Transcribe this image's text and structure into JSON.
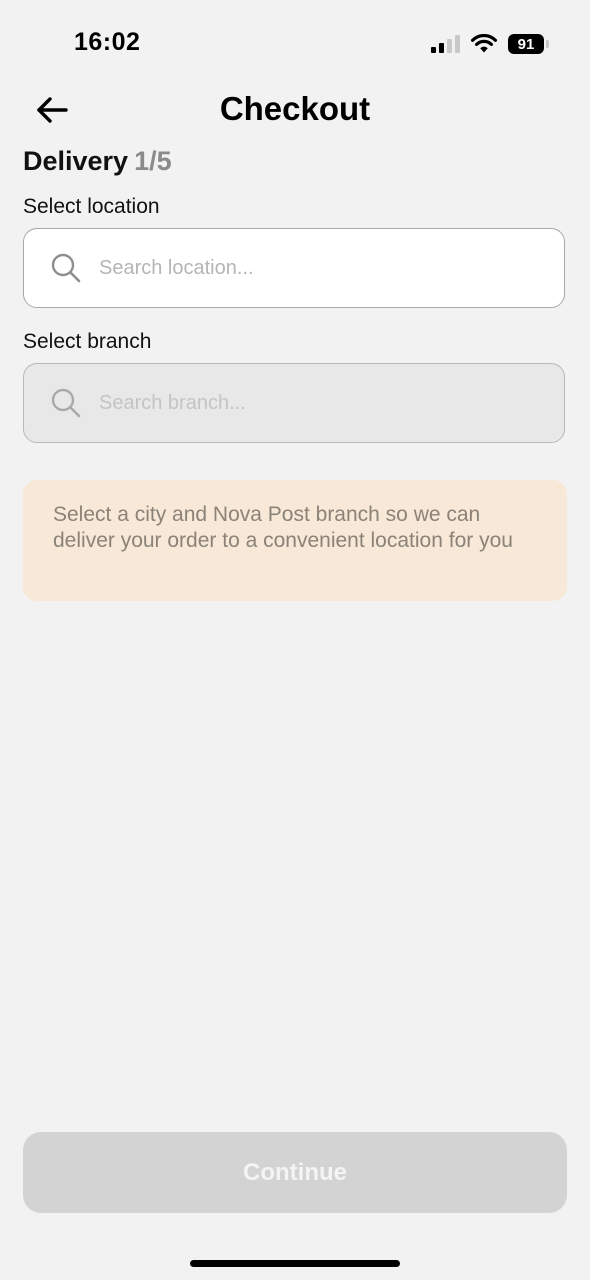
{
  "status_bar": {
    "time": "16:02",
    "battery_level": "91",
    "signal_bars_active": 2,
    "signal_bars_total": 4,
    "wifi_icon": "wifi-icon"
  },
  "header": {
    "back_icon": "arrow-left-icon",
    "title": "Checkout"
  },
  "step": {
    "title": "Delivery",
    "count": "1/5"
  },
  "location": {
    "label": "Select location",
    "placeholder": "Search location...",
    "value": "",
    "icon": "search-icon"
  },
  "branch": {
    "label": "Select branch",
    "placeholder": "Search branch...",
    "value": "",
    "icon": "search-icon",
    "disabled": true
  },
  "info": {
    "text": "Select a city and Nova Post branch so we can deliver your order to a convenient location for you"
  },
  "footer": {
    "continue_label": "Continue",
    "disabled": true
  },
  "colors": {
    "background": "#f2f2f2",
    "info_background": "#f7e8d7",
    "info_text": "#8c8378",
    "button_disabled": "#d3d3d3",
    "input_disabled": "#e8e8e8"
  }
}
